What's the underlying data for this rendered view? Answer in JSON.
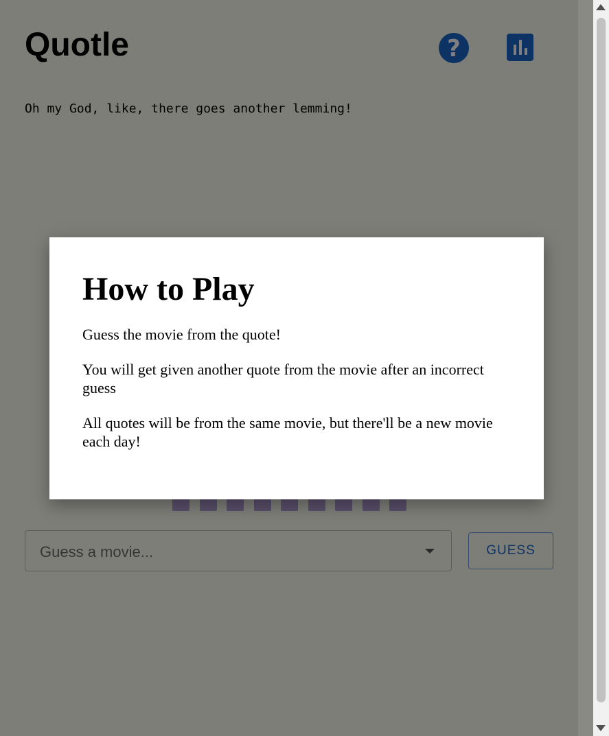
{
  "app": {
    "title": "Quotle",
    "help_icon": "question-circle-icon",
    "help_glyph": "?",
    "stats_icon": "bar-chart-icon"
  },
  "quote": {
    "text": "Oh my God, like, there goes another lemming!"
  },
  "guess_squares": {
    "count": 9
  },
  "guess_input": {
    "placeholder": "Guess a movie...",
    "dropdown_icon": "triangle-down-icon"
  },
  "guess_button": {
    "label": "GUESS"
  },
  "modal": {
    "title": "How to Play",
    "paragraphs": [
      "Guess the movie from the quote!",
      "You will get given another quote from the movie after an incorrect guess",
      "All quotes will be from the same movie, but there'll be a new movie each day!"
    ]
  },
  "colors": {
    "accent": "#1a66c9",
    "square": "#b49fd6"
  }
}
